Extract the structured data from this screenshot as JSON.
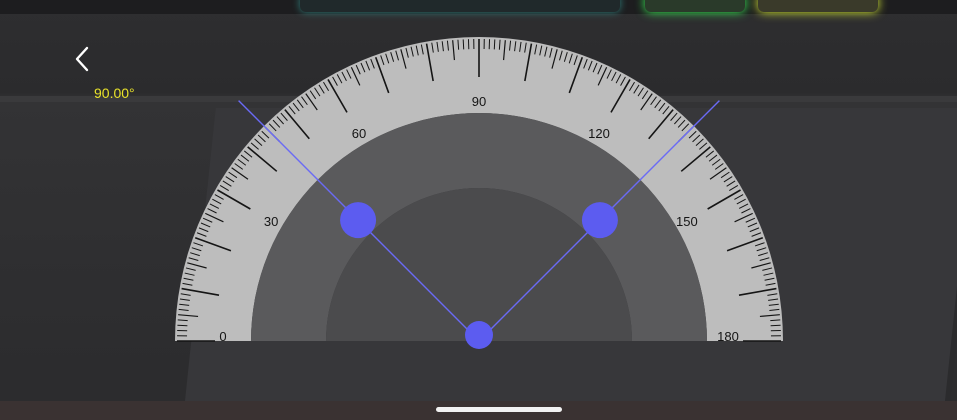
{
  "screen": {
    "back_icon": "chevron-left-icon",
    "angle_readout": "90.00°"
  },
  "protractor": {
    "scale_labels": [
      "0",
      "30",
      "60",
      "90",
      "120",
      "150",
      "180"
    ],
    "arm_left_angle_deg": 135,
    "arm_right_angle_deg": 45,
    "measured_angle_deg": 90
  },
  "colors": {
    "readout": "#e8e22a",
    "handle": "#5c5cf0",
    "arm_line": "#6a6af5",
    "scale_face": "#bdbdbd",
    "scale_inner": "#5a5a5c",
    "scale_core": "#4a4a4c",
    "tick": "#151515"
  },
  "system": {
    "home_indicator": "home-pill"
  }
}
